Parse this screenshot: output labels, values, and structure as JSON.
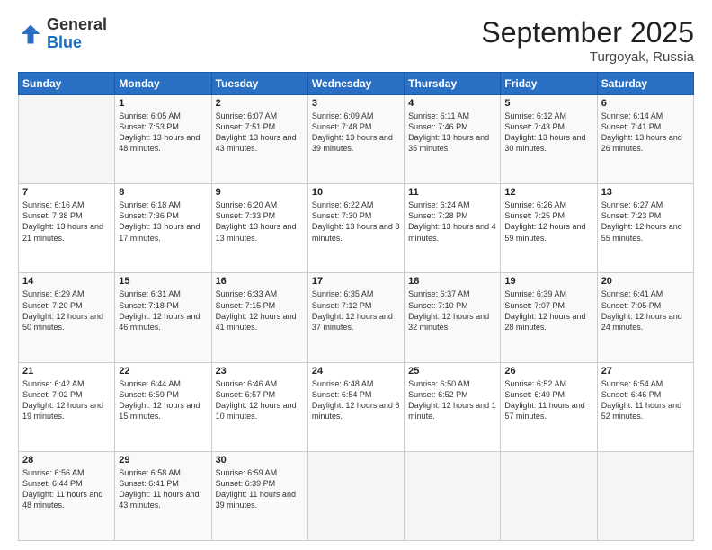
{
  "header": {
    "logo_general": "General",
    "logo_blue": "Blue",
    "month_title": "September 2025",
    "location": "Turgoyak, Russia"
  },
  "weekdays": [
    "Sunday",
    "Monday",
    "Tuesday",
    "Wednesday",
    "Thursday",
    "Friday",
    "Saturday"
  ],
  "weeks": [
    [
      {
        "day": "",
        "sunrise": "",
        "sunset": "",
        "daylight": ""
      },
      {
        "day": "1",
        "sunrise": "Sunrise: 6:05 AM",
        "sunset": "Sunset: 7:53 PM",
        "daylight": "Daylight: 13 hours and 48 minutes."
      },
      {
        "day": "2",
        "sunrise": "Sunrise: 6:07 AM",
        "sunset": "Sunset: 7:51 PM",
        "daylight": "Daylight: 13 hours and 43 minutes."
      },
      {
        "day": "3",
        "sunrise": "Sunrise: 6:09 AM",
        "sunset": "Sunset: 7:48 PM",
        "daylight": "Daylight: 13 hours and 39 minutes."
      },
      {
        "day": "4",
        "sunrise": "Sunrise: 6:11 AM",
        "sunset": "Sunset: 7:46 PM",
        "daylight": "Daylight: 13 hours and 35 minutes."
      },
      {
        "day": "5",
        "sunrise": "Sunrise: 6:12 AM",
        "sunset": "Sunset: 7:43 PM",
        "daylight": "Daylight: 13 hours and 30 minutes."
      },
      {
        "day": "6",
        "sunrise": "Sunrise: 6:14 AM",
        "sunset": "Sunset: 7:41 PM",
        "daylight": "Daylight: 13 hours and 26 minutes."
      }
    ],
    [
      {
        "day": "7",
        "sunrise": "Sunrise: 6:16 AM",
        "sunset": "Sunset: 7:38 PM",
        "daylight": "Daylight: 13 hours and 21 minutes."
      },
      {
        "day": "8",
        "sunrise": "Sunrise: 6:18 AM",
        "sunset": "Sunset: 7:36 PM",
        "daylight": "Daylight: 13 hours and 17 minutes."
      },
      {
        "day": "9",
        "sunrise": "Sunrise: 6:20 AM",
        "sunset": "Sunset: 7:33 PM",
        "daylight": "Daylight: 13 hours and 13 minutes."
      },
      {
        "day": "10",
        "sunrise": "Sunrise: 6:22 AM",
        "sunset": "Sunset: 7:30 PM",
        "daylight": "Daylight: 13 hours and 8 minutes."
      },
      {
        "day": "11",
        "sunrise": "Sunrise: 6:24 AM",
        "sunset": "Sunset: 7:28 PM",
        "daylight": "Daylight: 13 hours and 4 minutes."
      },
      {
        "day": "12",
        "sunrise": "Sunrise: 6:26 AM",
        "sunset": "Sunset: 7:25 PM",
        "daylight": "Daylight: 12 hours and 59 minutes."
      },
      {
        "day": "13",
        "sunrise": "Sunrise: 6:27 AM",
        "sunset": "Sunset: 7:23 PM",
        "daylight": "Daylight: 12 hours and 55 minutes."
      }
    ],
    [
      {
        "day": "14",
        "sunrise": "Sunrise: 6:29 AM",
        "sunset": "Sunset: 7:20 PM",
        "daylight": "Daylight: 12 hours and 50 minutes."
      },
      {
        "day": "15",
        "sunrise": "Sunrise: 6:31 AM",
        "sunset": "Sunset: 7:18 PM",
        "daylight": "Daylight: 12 hours and 46 minutes."
      },
      {
        "day": "16",
        "sunrise": "Sunrise: 6:33 AM",
        "sunset": "Sunset: 7:15 PM",
        "daylight": "Daylight: 12 hours and 41 minutes."
      },
      {
        "day": "17",
        "sunrise": "Sunrise: 6:35 AM",
        "sunset": "Sunset: 7:12 PM",
        "daylight": "Daylight: 12 hours and 37 minutes."
      },
      {
        "day": "18",
        "sunrise": "Sunrise: 6:37 AM",
        "sunset": "Sunset: 7:10 PM",
        "daylight": "Daylight: 12 hours and 32 minutes."
      },
      {
        "day": "19",
        "sunrise": "Sunrise: 6:39 AM",
        "sunset": "Sunset: 7:07 PM",
        "daylight": "Daylight: 12 hours and 28 minutes."
      },
      {
        "day": "20",
        "sunrise": "Sunrise: 6:41 AM",
        "sunset": "Sunset: 7:05 PM",
        "daylight": "Daylight: 12 hours and 24 minutes."
      }
    ],
    [
      {
        "day": "21",
        "sunrise": "Sunrise: 6:42 AM",
        "sunset": "Sunset: 7:02 PM",
        "daylight": "Daylight: 12 hours and 19 minutes."
      },
      {
        "day": "22",
        "sunrise": "Sunrise: 6:44 AM",
        "sunset": "Sunset: 6:59 PM",
        "daylight": "Daylight: 12 hours and 15 minutes."
      },
      {
        "day": "23",
        "sunrise": "Sunrise: 6:46 AM",
        "sunset": "Sunset: 6:57 PM",
        "daylight": "Daylight: 12 hours and 10 minutes."
      },
      {
        "day": "24",
        "sunrise": "Sunrise: 6:48 AM",
        "sunset": "Sunset: 6:54 PM",
        "daylight": "Daylight: 12 hours and 6 minutes."
      },
      {
        "day": "25",
        "sunrise": "Sunrise: 6:50 AM",
        "sunset": "Sunset: 6:52 PM",
        "daylight": "Daylight: 12 hours and 1 minute."
      },
      {
        "day": "26",
        "sunrise": "Sunrise: 6:52 AM",
        "sunset": "Sunset: 6:49 PM",
        "daylight": "Daylight: 11 hours and 57 minutes."
      },
      {
        "day": "27",
        "sunrise": "Sunrise: 6:54 AM",
        "sunset": "Sunset: 6:46 PM",
        "daylight": "Daylight: 11 hours and 52 minutes."
      }
    ],
    [
      {
        "day": "28",
        "sunrise": "Sunrise: 6:56 AM",
        "sunset": "Sunset: 6:44 PM",
        "daylight": "Daylight: 11 hours and 48 minutes."
      },
      {
        "day": "29",
        "sunrise": "Sunrise: 6:58 AM",
        "sunset": "Sunset: 6:41 PM",
        "daylight": "Daylight: 11 hours and 43 minutes."
      },
      {
        "day": "30",
        "sunrise": "Sunrise: 6:59 AM",
        "sunset": "Sunset: 6:39 PM",
        "daylight": "Daylight: 11 hours and 39 minutes."
      },
      {
        "day": "",
        "sunrise": "",
        "sunset": "",
        "daylight": ""
      },
      {
        "day": "",
        "sunrise": "",
        "sunset": "",
        "daylight": ""
      },
      {
        "day": "",
        "sunrise": "",
        "sunset": "",
        "daylight": ""
      },
      {
        "day": "",
        "sunrise": "",
        "sunset": "",
        "daylight": ""
      }
    ]
  ]
}
